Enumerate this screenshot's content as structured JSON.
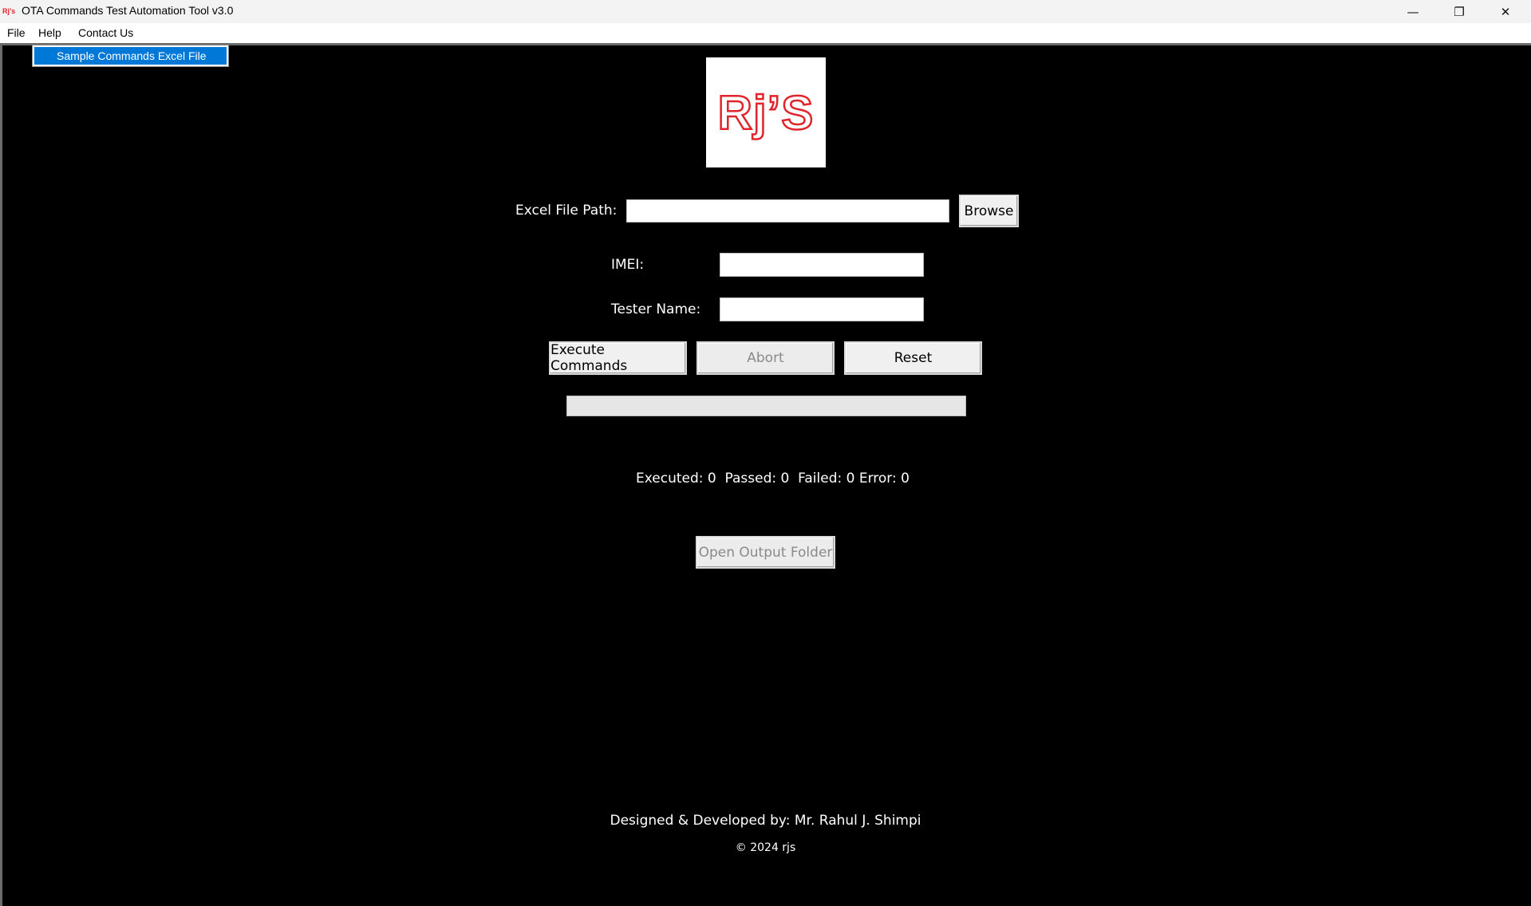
{
  "window": {
    "icon_text": "Rj's",
    "title": "OTA Commands Test Automation Tool v3.0",
    "controls": {
      "minimize": "—",
      "restore": "❐",
      "close": "✕"
    }
  },
  "menubar": {
    "items": [
      "File",
      "Help",
      "Contact Us"
    ]
  },
  "dropdown": {
    "items": [
      "Sample Commands Excel File"
    ]
  },
  "logo": {
    "text": "Rj’S",
    "color": "#e0242b"
  },
  "form": {
    "excel_label": "Excel File Path:",
    "excel_value": "",
    "browse_label": "Browse",
    "imei_label": "IMEI:",
    "imei_value": "",
    "tester_label": "Tester Name:",
    "tester_value": ""
  },
  "actions": {
    "execute_label": "Execute Commands",
    "abort_label": "Abort",
    "reset_label": "Reset"
  },
  "progress": {
    "value": 0
  },
  "stats": {
    "text": "Executed: 0  Passed: 0  Failed: 0 Error: 0"
  },
  "output": {
    "open_folder_label": "Open Output Folder"
  },
  "footer": {
    "credit": "Designed & Developed by: Mr. Rahul J. Shimpi",
    "copyright": "© 2024 rjs"
  },
  "colors": {
    "background": "#000000",
    "menu_highlight": "#0078d7",
    "progress_fill": "#06b025"
  }
}
